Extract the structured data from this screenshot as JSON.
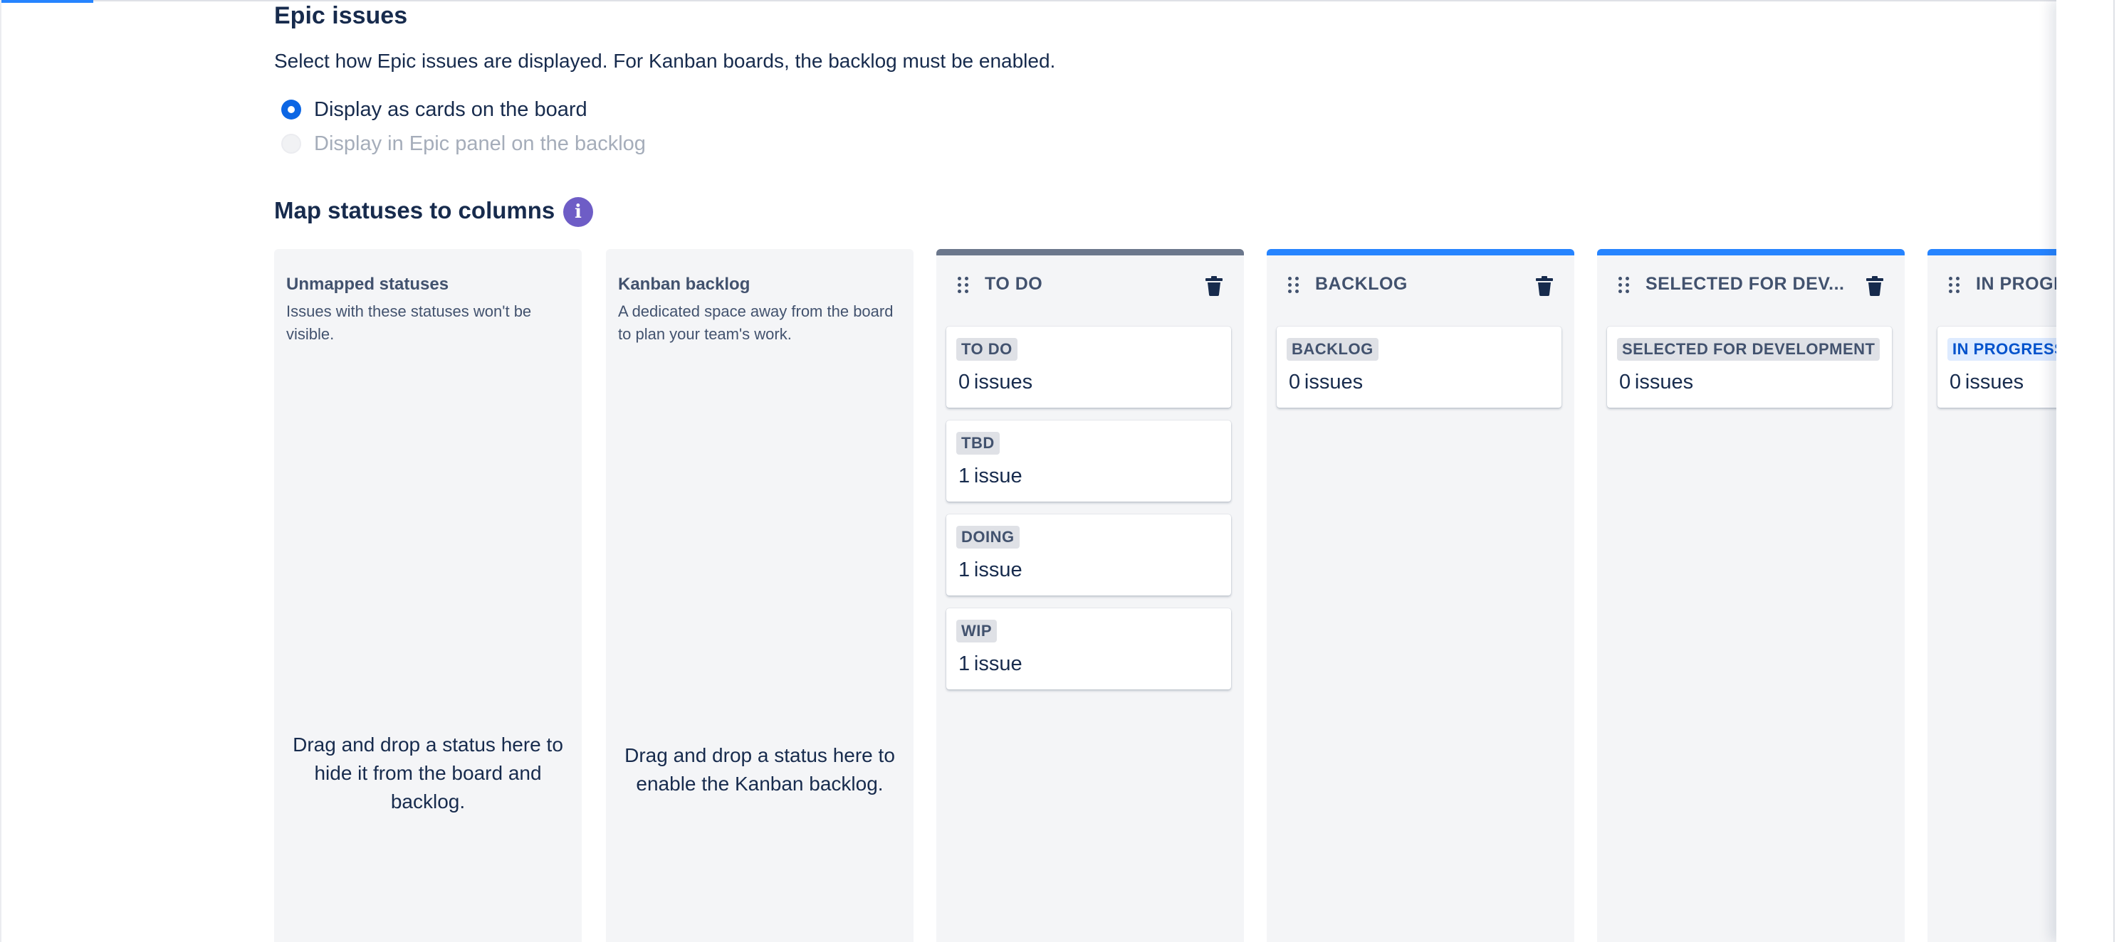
{
  "epic": {
    "title": "Epic issues",
    "description": "Select how Epic issues are displayed. For Kanban boards, the backlog must be enabled.",
    "options": [
      {
        "label": "Display as cards on the board",
        "checked": true,
        "disabled": false
      },
      {
        "label": "Display in Epic panel on the backlog",
        "checked": false,
        "disabled": true
      }
    ]
  },
  "map": {
    "title": "Map statuses to columns",
    "info_icon": "i"
  },
  "unmapped": {
    "title": "Unmapped statuses",
    "subtitle": "Issues with these statuses won't be visible.",
    "drop_text": "Drag and drop a status here to hide it from the board and backlog."
  },
  "kanban_backlog": {
    "title": "Kanban backlog",
    "subtitle": "A dedicated space away from the board to plan your team's work.",
    "drop_text": "Drag and drop a status here to enable the Kanban backlog."
  },
  "columns": [
    {
      "title": "TO DO",
      "cards": [
        {
          "status": "TO DO",
          "count": "0 issues"
        },
        {
          "status": "TBD",
          "count": "1 issue"
        },
        {
          "status": "DOING",
          "count": "1 issue"
        },
        {
          "status": "WIP",
          "count": "1 issue"
        }
      ]
    },
    {
      "title": "BACKLOG",
      "cards": [
        {
          "status": "BACKLOG",
          "count": "0 issues"
        }
      ]
    },
    {
      "title": "SELECTED FOR DEV...",
      "cards": [
        {
          "status": "SELECTED FOR DEVELOPMENT",
          "count": "0 issues"
        }
      ]
    },
    {
      "title": "IN PROGRESS",
      "cards": [
        {
          "status": "IN PROGRESS",
          "count": "0 issues"
        }
      ]
    }
  ],
  "icons": {
    "drag": "drag-handle-icon",
    "trash": "trash-icon",
    "info": "info-icon"
  },
  "colors": {
    "accent": "#0c66e4",
    "column_todo_bar": "#6b778c",
    "column_blue_bar": "#2684ff",
    "info_purple": "#6e5dc6",
    "lozenge_blue_text": "#0052cc"
  }
}
